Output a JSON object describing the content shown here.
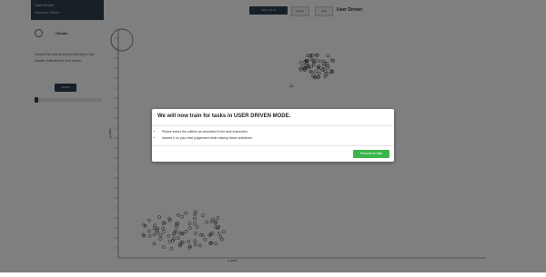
{
  "sidebar": {
    "title": "User Driven",
    "subtitle": "Selection Mode",
    "radio_label": "Cluster",
    "help_text": "Select the points which belong to the cluster indicated in the menu.",
    "button_label": "Submit"
  },
  "toolbar": {
    "select_label": "Task 1 of 10",
    "button1": "Reset",
    "button2": "Help",
    "title": "User Driven"
  },
  "plot": {
    "y_label": "y-axis",
    "x_label": "x-axis",
    "cluster_label": "A1"
  },
  "modal": {
    "title": "We will now train for tasks in USER DRIVEN MODE.",
    "bullets": [
      "Please select the outliers as described in the task instruction.",
      "Assess it on your best judgement while making these selections."
    ],
    "button_label": "Proceed to task"
  },
  "colors": {
    "header_dark": "#2f3e4f",
    "primary_green": "#3bb54a"
  }
}
